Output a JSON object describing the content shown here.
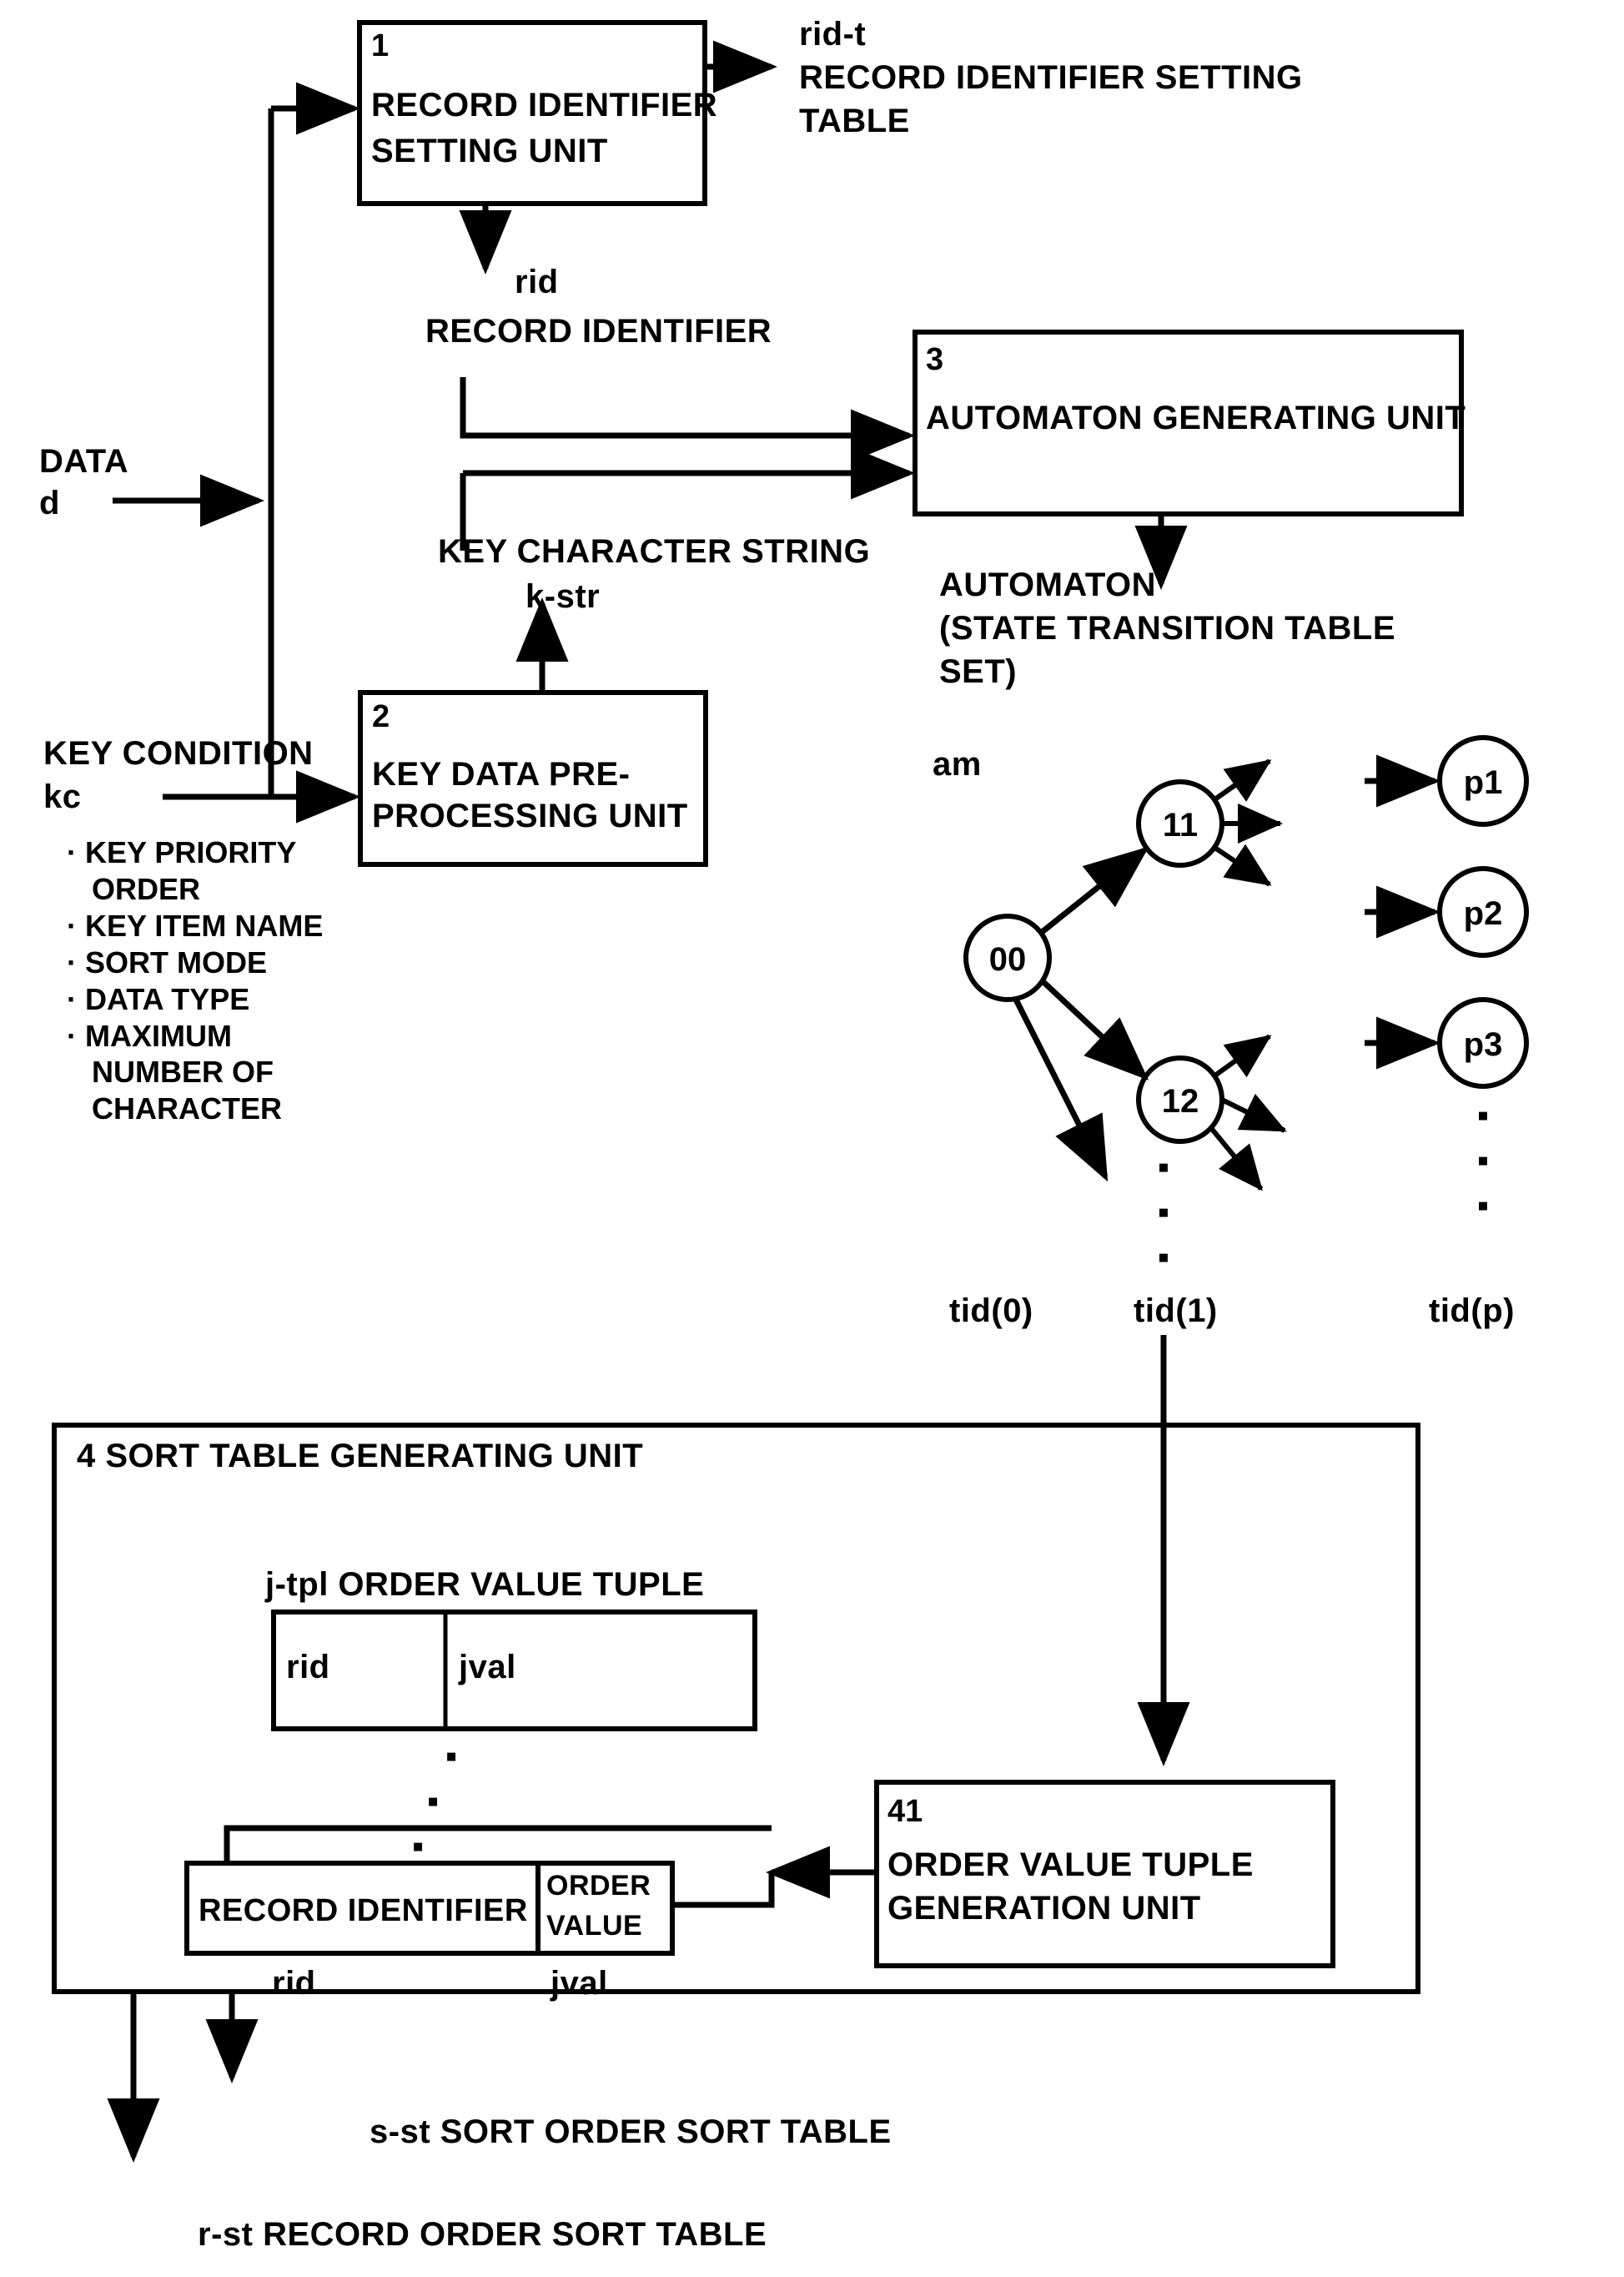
{
  "diagram": {
    "title": "Sort table generating system block diagram",
    "boxes": {
      "b1": {
        "num": "1",
        "line1": "RECORD IDENTIFIER",
        "line2": "SETTING UNIT"
      },
      "b2": {
        "num": "2",
        "line1": "KEY DATA PRE-",
        "line2": "PROCESSING UNIT"
      },
      "b3": {
        "num": "3",
        "line1": "AUTOMATON GENERATING UNIT"
      },
      "b4": {
        "label": "4 SORT TABLE GENERATING UNIT"
      },
      "b41": {
        "num": "41",
        "line1": "ORDER VALUE TUPLE",
        "line2": "GENERATION UNIT"
      }
    },
    "labels": {
      "rid_t_line1": "rid-t",
      "rid_t_line2": "RECORD IDENTIFIER SETTING",
      "rid_t_line3": "TABLE",
      "rid_line1": "rid",
      "rid_line2": "RECORD IDENTIFIER",
      "data_line1": "DATA",
      "data_line2": "d",
      "key_condition_line1": "KEY CONDITION",
      "key_condition_line2": "kc",
      "key_char_string_line1": "KEY CHARACTER STRING",
      "key_char_string_line2": "k-str",
      "automaton_line1": "AUTOMATON",
      "automaton_line2": "(STATE TRANSITION TABLE",
      "automaton_line3": "SET)",
      "am": "am",
      "j_tpl": "j-tpl ORDER VALUE TUPLE",
      "s_st": "s-st SORT ORDER SORT TABLE",
      "r_st": "r-st RECORD ORDER SORT TABLE"
    },
    "key_condition_items": [
      "· KEY PRIORITY",
      "   ORDER",
      "· KEY ITEM NAME",
      "· SORT MODE",
      "· DATA TYPE",
      "· MAXIMUM",
      "   NUMBER OF",
      "   CHARACTER"
    ],
    "automaton_nodes": [
      {
        "id": "s00",
        "label": "00"
      },
      {
        "id": "s11",
        "label": "11"
      },
      {
        "id": "s12",
        "label": "12"
      },
      {
        "id": "p1",
        "label": "p1"
      },
      {
        "id": "p2",
        "label": "p2"
      },
      {
        "id": "p3",
        "label": "p3"
      }
    ],
    "tid_labels": [
      "tid(0)",
      "tid(1)",
      "tid(p)"
    ],
    "tuple_table_top": {
      "cell1": "rid",
      "cell2": "jval"
    },
    "tuple_table_bottom": {
      "cell1": "RECORD IDENTIFIER",
      "cell2_line1": "ORDER",
      "cell2_line2": "VALUE",
      "caption1": "rid",
      "caption2": "jval"
    },
    "colors": {
      "ink": "#000000",
      "paper": "#ffffff"
    }
  }
}
